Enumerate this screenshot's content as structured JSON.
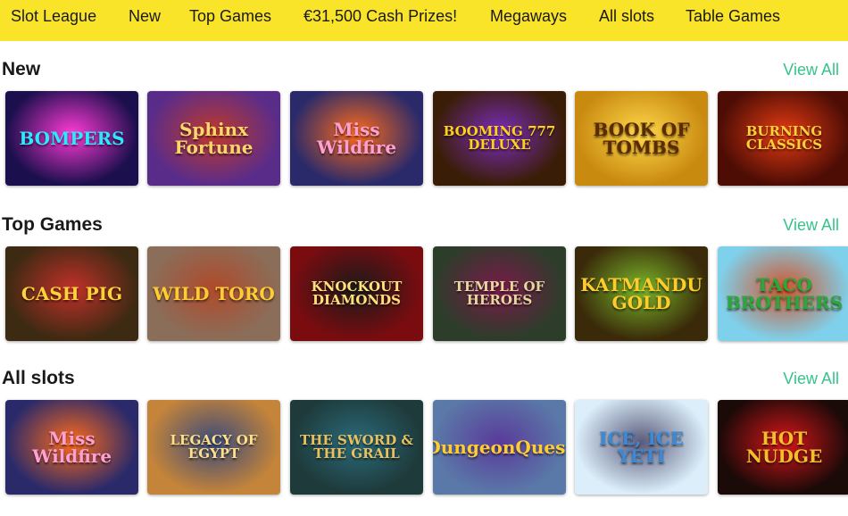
{
  "nav": {
    "items": [
      "Slot League",
      "New",
      "Top Games",
      "€31,500 Cash Prizes!",
      "Megaways",
      "All slots",
      "Table Games"
    ]
  },
  "colors": {
    "nav_bg": "#f9e42a",
    "view_all": "#35c48a"
  },
  "sections": [
    {
      "title": "New",
      "view_all": "View All",
      "games": [
        {
          "title": "BOMPERS",
          "bg": "#1b0f4d",
          "fg": "#2ee8ff",
          "accent": "#ff3ad6"
        },
        {
          "title": "Sphinx Fortune",
          "bg": "#5a2c8a",
          "fg": "#ffd66b",
          "accent": "#c0392b"
        },
        {
          "title": "Miss Wildfire",
          "bg": "#2a2a6a",
          "fg": "#ff9fd2",
          "accent": "#ff6a1a"
        },
        {
          "title": "BOOMING 777 DELUXE",
          "bg": "#3a1d06",
          "fg": "#ffd11a",
          "accent": "#7b2cbf"
        },
        {
          "title": "BOOK OF TOMBS",
          "bg": "#c98a10",
          "fg": "#5a2a00",
          "accent": "#ffd84a"
        },
        {
          "title": "BURNING CLASSICS",
          "bg": "#4d0d05",
          "fg": "#ffcf3a",
          "accent": "#e63b12"
        }
      ]
    },
    {
      "title": "Top Games",
      "view_all": "View All",
      "games": [
        {
          "title": "CASH PIG",
          "bg": "#3d2a12",
          "fg": "#ffd23a",
          "accent": "#c2302a"
        },
        {
          "title": "WILD TORO",
          "bg": "#8a6e5a",
          "fg": "#ffcc33",
          "accent": "#b04a2a"
        },
        {
          "title": "KNOCKOUT DIAMONDS",
          "bg": "#7a0c10",
          "fg": "#ffe07a",
          "accent": "#1a1a1a"
        },
        {
          "title": "TEMPLE OF HEROES",
          "bg": "#2c3d2a",
          "fg": "#e8d8a0",
          "accent": "#7a1a4a"
        },
        {
          "title": "KATMANDU GOLD",
          "bg": "#3a2a0a",
          "fg": "#ffcc2a",
          "accent": "#7ab82a"
        },
        {
          "title": "TACO BROTHERS",
          "bg": "#7fd0ea",
          "fg": "#2aa83a",
          "accent": "#d2542a"
        }
      ]
    },
    {
      "title": "All slots",
      "view_all": "View All",
      "games": [
        {
          "title": "Miss Wildfire",
          "bg": "#2a2a6a",
          "fg": "#ff9fd2",
          "accent": "#ff6a1a"
        },
        {
          "title": "LEGACY OF EGYPT",
          "bg": "#c4843a",
          "fg": "#ffe08a",
          "accent": "#3a4a7a"
        },
        {
          "title": "THE SWORD & THE GRAIL",
          "bg": "#1e3a3a",
          "fg": "#e8c060",
          "accent": "#2a6a7a"
        },
        {
          "title": "DungeonQuest",
          "bg": "#5a78a8",
          "fg": "#ffcc33",
          "accent": "#5a3a9a"
        },
        {
          "title": "ICE, ICE YETI",
          "bg": "#dbeefa",
          "fg": "#3a8ad8",
          "accent": "#5a5a7a"
        },
        {
          "title": "HOT NUDGE",
          "bg": "#1a0a08",
          "fg": "#f2c12a",
          "accent": "#d8151a"
        }
      ]
    }
  ]
}
